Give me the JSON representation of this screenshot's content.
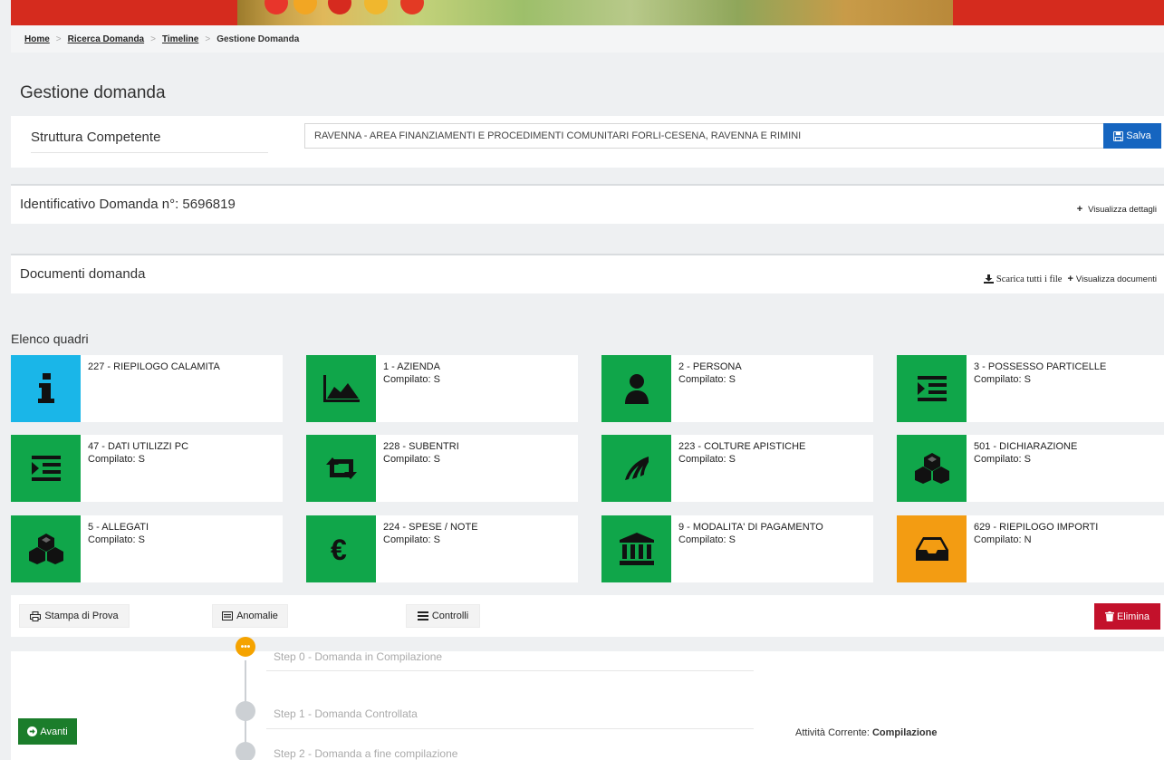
{
  "breadcrumb": {
    "home": "Home",
    "ricerca": "Ricerca Domanda",
    "timeline": "Timeline",
    "current": "Gestione Domanda"
  },
  "page_title": "Gestione domanda",
  "struttura": {
    "label": "Struttura Competente",
    "value": "RAVENNA - AREA FINANZIAMENTI E PROCEDIMENTI COMUNITARI FORLI-CESENA, RAVENNA E RIMINI",
    "save_label": "Salva"
  },
  "identificativo": {
    "title": "Identificativo Domanda n°: 5696819",
    "details_label": "Visualizza dettagli"
  },
  "documenti": {
    "title": "Documenti domanda",
    "download_label": "Scarica tutti i file",
    "view_label": "Visualizza documenti"
  },
  "quadri_label": "Elenco quadri",
  "quadri": [
    {
      "title": "227 - RIEPILOGO CALAMITA",
      "status": "",
      "icon": "info-icon",
      "color": "#1ab6e8"
    },
    {
      "title": "1 - AZIENDA",
      "status": "Compilato: S",
      "icon": "area-chart-icon",
      "color": "#10a64a"
    },
    {
      "title": "2 - PERSONA",
      "status": "Compilato: S",
      "icon": "user-icon",
      "color": "#10a64a"
    },
    {
      "title": "3 - POSSESSO PARTICELLE",
      "status": "Compilato: S",
      "icon": "indent-icon",
      "color": "#10a64a"
    },
    {
      "title": "47 - DATI UTILIZZI PC",
      "status": "Compilato: S",
      "icon": "indent-icon",
      "color": "#10a64a"
    },
    {
      "title": "228 - SUBENTRI",
      "status": "Compilato: S",
      "icon": "retweet-icon",
      "color": "#10a64a"
    },
    {
      "title": "223 - COLTURE APISTICHE",
      "status": "Compilato: S",
      "icon": "feather-icon",
      "color": "#10a64a"
    },
    {
      "title": "501 - DICHIARAZIONE",
      "status": "Compilato: S",
      "icon": "cubes-icon",
      "color": "#10a64a"
    },
    {
      "title": "5 - ALLEGATI",
      "status": "Compilato: S",
      "icon": "cubes-icon",
      "color": "#10a64a"
    },
    {
      "title": "224 - SPESE / NOTE",
      "status": "Compilato: S",
      "icon": "euro-icon",
      "color": "#10a64a"
    },
    {
      "title": "9 - MODALITA' DI PAGAMENTO",
      "status": "Compilato: S",
      "icon": "bank-icon",
      "color": "#10a64a"
    },
    {
      "title": "629 - RIEPILOGO IMPORTI",
      "status": "Compilato: N",
      "icon": "inbox-icon",
      "color": "#f39c12"
    }
  ],
  "toolbar": {
    "stampa": "Stampa di Prova",
    "anomalie": "Anomalie",
    "controlli": "Controlli",
    "elimina": "Elimina"
  },
  "workflow": {
    "avanti": "Avanti",
    "steps": [
      {
        "label": "Step 0 - Domanda in Compilazione",
        "state": "active"
      },
      {
        "label": "Step 1 - Domanda Controllata",
        "state": "pending"
      },
      {
        "label": "Step 2 - Domanda a fine compilazione",
        "state": "pending"
      }
    ],
    "current_label": "Attività Corrente:",
    "current_value": "Compilazione"
  }
}
